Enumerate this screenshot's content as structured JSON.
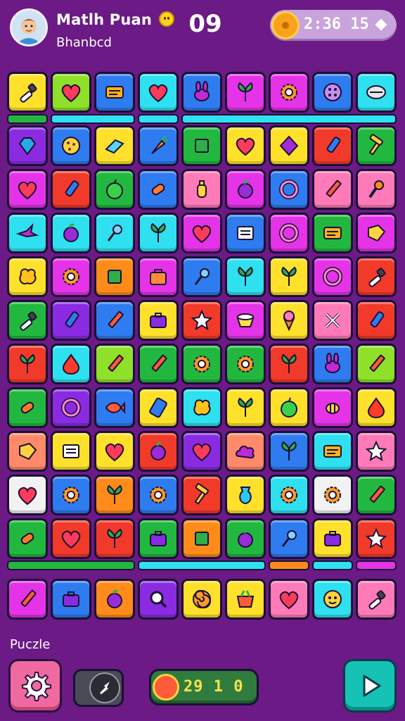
{
  "header": {
    "title": "Matlh Puan",
    "subtitle": "Bhanbcd",
    "moves": "09",
    "timer": "2:36 15",
    "avatar_icon": "avatar-boy",
    "coin_icon": "coin-icon"
  },
  "footer": {
    "label": "Puczle",
    "score": "29 1 0",
    "settings_icon": "gear-icon",
    "boost_icon": "bolt-icon",
    "play_icon": "play-icon"
  },
  "colors": {
    "background": "#6b1a86",
    "yellow": "#ffe12b",
    "lime": "#8fe02a",
    "blue": "#2f7bf0",
    "cyan": "#2fe0f0",
    "magenta": "#e533e8",
    "green": "#22b83f",
    "red": "#f23a2a",
    "orange": "#ff8c1a",
    "pink": "#ff7ab8",
    "purple": "#8a2be2",
    "white": "#f2f2f2",
    "salmon": "#ff8a6a"
  },
  "board": {
    "rows": [
      [
        "yellow:brush",
        "lime:heart",
        "blue:card",
        "cyan:heart",
        "blue:bunny",
        "magenta:leaf",
        "magenta:gear",
        "blue:button",
        "cyan:pill"
      ],
      [
        "purple:gem",
        "blue:cookie",
        "yellow:eraser",
        "blue:carrot",
        "green:box",
        "yellow:heart",
        "yellow:diamond",
        "red:marker",
        "green:hammer"
      ],
      [
        "magenta:heart",
        "red:marker",
        "green:apple",
        "blue:candy",
        "pink:bottle",
        "magenta:fruit",
        "blue:ring",
        "pink:pencil",
        "pink:mic"
      ],
      [
        "cyan:bird",
        "cyan:fruit",
        "cyan:pin",
        "cyan:leaf",
        "magenta:heart",
        "blue:note",
        "magenta:ring",
        "green:card",
        "magenta:tag"
      ],
      [
        "yellow:blob",
        "magenta:gear",
        "orange:box",
        "magenta:bag",
        "blue:pin",
        "cyan:leaf",
        "yellow:leaf",
        "magenta:ring",
        "red:brush"
      ],
      [
        "green:brush",
        "purple:marker",
        "blue:pencil",
        "yellow:case",
        "red:star",
        "magenta:cake",
        "yellow:cone",
        "pink:tools",
        "red:marker"
      ],
      [
        "red:leaf",
        "cyan:drop",
        "lime:pencil",
        "green:pencil",
        "green:gear",
        "green:gear",
        "red:leaf",
        "blue:bunny",
        "lime:pencil"
      ],
      [
        "green:candy",
        "purple:ring",
        "blue:fish",
        "yellow:phone",
        "cyan:blob",
        "yellow:leaf",
        "yellow:apple",
        "magenta:bee",
        "yellow:drop"
      ],
      [
        "salmon:tag",
        "yellow:note",
        "yellow:heart",
        "red:fruit",
        "purple:heart",
        "salmon:cloud",
        "blue:leaf",
        "cyan:card",
        "pink:star"
      ],
      [
        "white:heart",
        "blue:gear",
        "orange:leaf",
        "blue:gear",
        "red:hammer",
        "yellow:vase",
        "cyan:gear",
        "white:gear",
        "green:pencil"
      ],
      [
        "green:candy",
        "red:heart",
        "red:leaf",
        "green:case",
        "orange:box",
        "green:fruit",
        "blue:pin",
        "yellow:case",
        "red:star"
      ],
      [
        "magenta:pencil",
        "blue:case",
        "orange:fruit",
        "purple:search",
        "yellow:spiral",
        "yellow:basket",
        "pink:heart",
        "cyan:face",
        "pink:brush"
      ]
    ],
    "strips_top": [
      "green",
      "cyan",
      "cyan",
      "cyan"
    ],
    "strips_bottom": [
      "green",
      "cyan",
      "orange",
      "cyan",
      "magenta"
    ]
  }
}
